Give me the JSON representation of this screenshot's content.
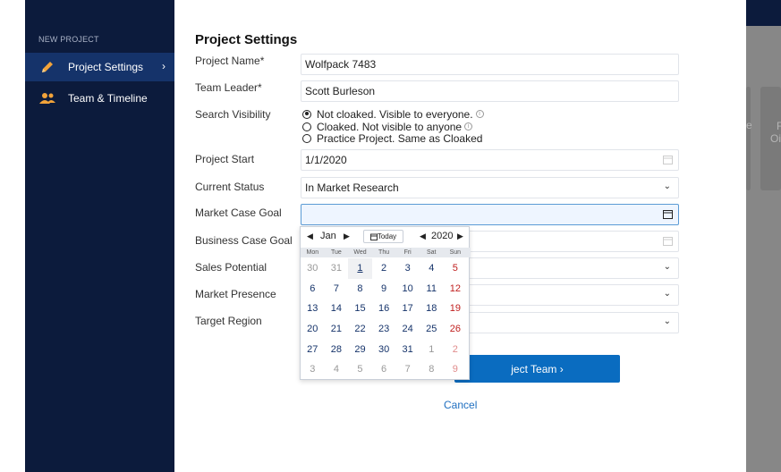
{
  "sidebar": {
    "heading": "NEW PROJECT",
    "items": [
      {
        "label": "Project Settings",
        "icon": "pencil-icon",
        "active": true,
        "chevron": "›"
      },
      {
        "label": "Team & Timeline",
        "icon": "team-icon",
        "active": false
      }
    ]
  },
  "form": {
    "title": "Project Settings",
    "project_name": {
      "label": "Project Name*",
      "value": "Wolfpack 7483"
    },
    "team_leader": {
      "label": "Team Leader*",
      "value": "Scott Burleson"
    },
    "search_visibility": {
      "label": "Search Visibility",
      "options": [
        {
          "text": "Not cloaked. Visible to everyone.",
          "selected": true,
          "info": true
        },
        {
          "text": "Cloaked. Not visible to anyone",
          "selected": false,
          "info": true
        },
        {
          "text": "Practice Project. Same as Cloaked",
          "selected": false,
          "info": false
        }
      ]
    },
    "project_start": {
      "label": "Project Start",
      "value": "1/1/2020"
    },
    "current_status": {
      "label": "Current Status",
      "value": "In Market Research"
    },
    "market_case_goal": {
      "label": "Market Case Goal",
      "value": ""
    },
    "business_case_goal": {
      "label": "Business Case Goal",
      "value": ""
    },
    "sales_potential": {
      "label": "Sales Potential",
      "value": ""
    },
    "market_presence": {
      "label": "Market Presence",
      "value": ""
    },
    "target_region": {
      "label": "Target Region",
      "value": ""
    },
    "primary_button": "ject Team ›",
    "cancel_label": "Cancel"
  },
  "datepicker": {
    "month": "Jan",
    "year": "2020",
    "today_label": "Today",
    "weekdays": [
      "Mon",
      "Tue",
      "Wed",
      "Thu",
      "Fri",
      "Sat",
      "Sun"
    ],
    "weeks": [
      [
        "30",
        "31",
        "1",
        "2",
        "3",
        "4",
        "5"
      ],
      [
        "6",
        "7",
        "8",
        "9",
        "10",
        "11",
        "12"
      ],
      [
        "13",
        "14",
        "15",
        "16",
        "17",
        "18",
        "19"
      ],
      [
        "20",
        "21",
        "22",
        "23",
        "24",
        "25",
        "26"
      ],
      [
        "27",
        "28",
        "29",
        "30",
        "31",
        "1",
        "2"
      ],
      [
        "3",
        "4",
        "5",
        "6",
        "7",
        "8",
        "9"
      ]
    ]
  },
  "background_cards": {
    "text_1": "F",
    "text_2": "Oi",
    "text_3": "e"
  },
  "colors": {
    "sidebar": "#0c1b3c",
    "sidebar_active": "#15336a",
    "accent": "#0a6cc0",
    "weekend": "#c0201f"
  }
}
